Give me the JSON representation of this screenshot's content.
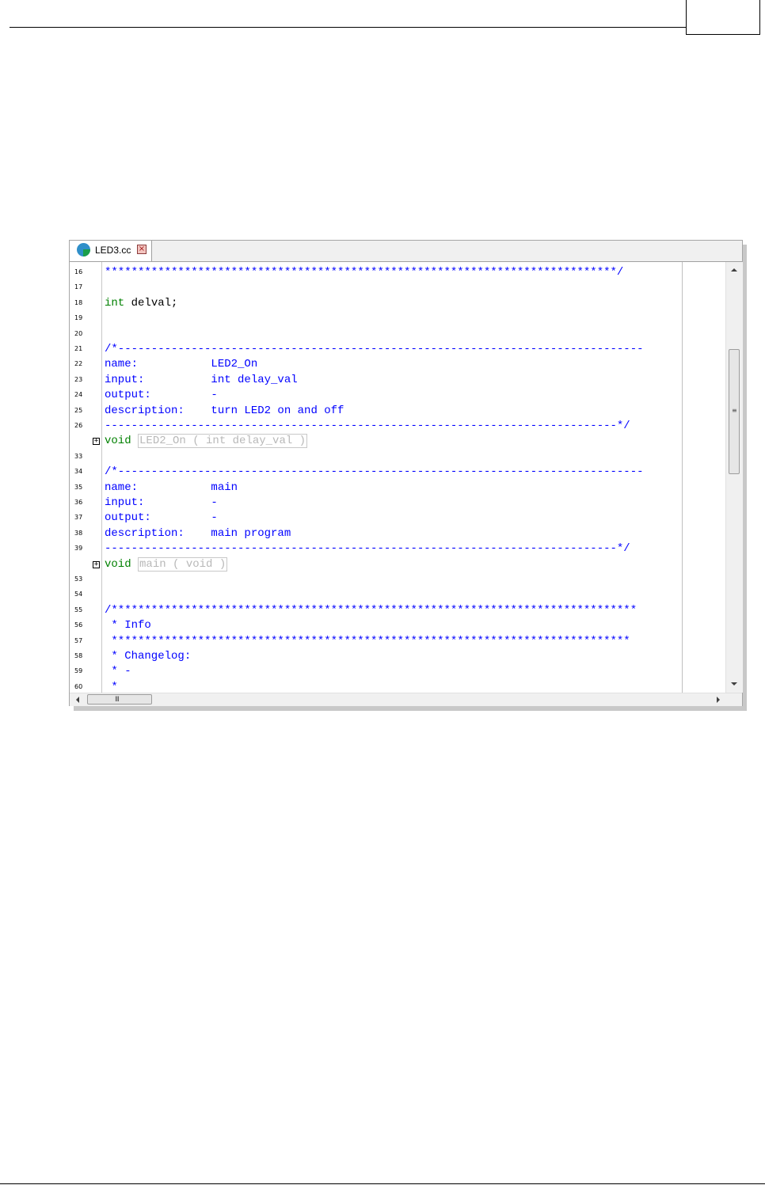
{
  "tab": {
    "label": "LED3.cc",
    "close_glyph": "×",
    "icon": "cc-file-icon"
  },
  "editor": {
    "lines": [
      {
        "num": "16",
        "segments": [
          {
            "t": "*****************************************************************************/",
            "c": "blue"
          }
        ]
      },
      {
        "num": "17",
        "segments": []
      },
      {
        "num": "18",
        "segments": [
          {
            "t": "int",
            "c": "green"
          },
          {
            "t": " delval;",
            "c": "black"
          }
        ]
      },
      {
        "num": "19",
        "segments": []
      },
      {
        "num": "20",
        "segments": []
      },
      {
        "num": "21",
        "segments": [
          {
            "t": "/*-------------------------------------------------------------------------------",
            "c": "blue"
          }
        ]
      },
      {
        "num": "22",
        "segments": [
          {
            "t": "name:           LED2_On",
            "c": "blue"
          }
        ]
      },
      {
        "num": "23",
        "segments": [
          {
            "t": "input:          int delay_val",
            "c": "blue"
          }
        ]
      },
      {
        "num": "24",
        "segments": [
          {
            "t": "output:         -",
            "c": "blue"
          }
        ]
      },
      {
        "num": "25",
        "segments": [
          {
            "t": "description:    turn LED2 on and off",
            "c": "blue"
          }
        ]
      },
      {
        "num": "26",
        "segments": [
          {
            "t": "-----------------------------------------------------------------------------*/",
            "c": "blue"
          }
        ]
      },
      {
        "num": "",
        "fold": true,
        "segments": [
          {
            "t": "void",
            "c": "green"
          },
          {
            "t": " ",
            "c": "black"
          },
          {
            "t": "LED2_On ( int delay_val )",
            "c": "folded"
          }
        ]
      },
      {
        "num": "33",
        "segments": []
      },
      {
        "num": "34",
        "segments": [
          {
            "t": "/*-------------------------------------------------------------------------------",
            "c": "blue"
          }
        ]
      },
      {
        "num": "35",
        "segments": [
          {
            "t": "name:           main",
            "c": "blue"
          }
        ]
      },
      {
        "num": "36",
        "segments": [
          {
            "t": "input:          -",
            "c": "blue"
          }
        ]
      },
      {
        "num": "37",
        "segments": [
          {
            "t": "output:         -",
            "c": "blue"
          }
        ]
      },
      {
        "num": "38",
        "segments": [
          {
            "t": "description:    main program",
            "c": "blue"
          }
        ]
      },
      {
        "num": "39",
        "segments": [
          {
            "t": "-----------------------------------------------------------------------------*/",
            "c": "blue"
          }
        ]
      },
      {
        "num": "",
        "fold": true,
        "segments": [
          {
            "t": "void",
            "c": "green"
          },
          {
            "t": " ",
            "c": "black"
          },
          {
            "t": "main ( void )",
            "c": "folded"
          }
        ]
      },
      {
        "num": "53",
        "segments": []
      },
      {
        "num": "54",
        "segments": []
      },
      {
        "num": "55",
        "segments": [
          {
            "t": "/*******************************************************************************",
            "c": "blue"
          }
        ]
      },
      {
        "num": "56",
        "segments": [
          {
            "t": " * Info",
            "c": "blue"
          }
        ]
      },
      {
        "num": "57",
        "segments": [
          {
            "t": " ******************************************************************************",
            "c": "blue"
          }
        ]
      },
      {
        "num": "58",
        "segments": [
          {
            "t": " * Changelog:",
            "c": "blue"
          }
        ]
      },
      {
        "num": "59",
        "segments": [
          {
            "t": " * -",
            "c": "blue"
          }
        ]
      },
      {
        "num": "60",
        "segments": [
          {
            "t": " *",
            "c": "blue"
          }
        ]
      }
    ]
  },
  "colors": {
    "blue": "#0000ff",
    "green": "#008000",
    "black": "#000000",
    "folded": "#b8b8b8"
  }
}
